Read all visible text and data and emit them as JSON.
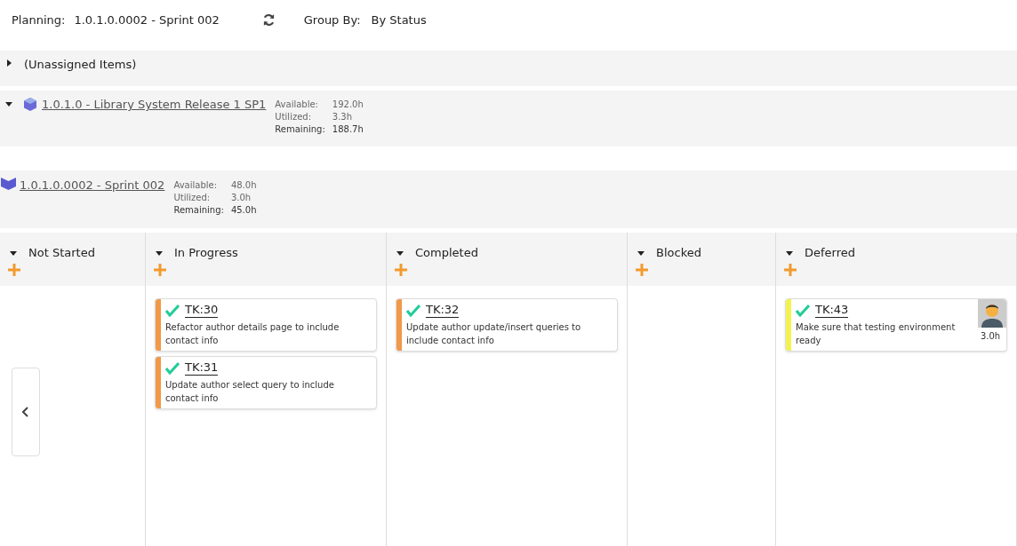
{
  "header": {
    "planning_label": "Planning:",
    "planning_value": "1.0.1.0.0002 - Sprint 002",
    "group_label": "Group By:",
    "group_value": "By Status"
  },
  "unassigned": {
    "label": "(Unassigned Items)",
    "expanded": false
  },
  "release": {
    "title": "1.0.1.0 - Library System Release 1 SP1",
    "expanded": true,
    "stats": [
      {
        "label": "Available:",
        "value": "192.0h"
      },
      {
        "label": "Utilized:",
        "value": "3.3h"
      },
      {
        "label": "Remaining:",
        "value": "188.7h"
      }
    ]
  },
  "sprint": {
    "title": "1.0.1.0.0002 - Sprint 002",
    "stats": [
      {
        "label": "Available:",
        "value": "48.0h"
      },
      {
        "label": "Utilized:",
        "value": "3.0h"
      },
      {
        "label": "Remaining:",
        "value": "45.0h"
      }
    ]
  },
  "columns": [
    {
      "title": "Not Started",
      "expanded": true
    },
    {
      "title": "In Progress",
      "expanded": true,
      "cards": [
        {
          "id": "TK:30",
          "text": "Refactor author details page to include contact info",
          "color": "#f0994a"
        },
        {
          "id": "TK:31",
          "text": "Update author select query to include contact info",
          "color": "#f0994a"
        }
      ]
    },
    {
      "title": "Completed",
      "expanded": true,
      "cards": [
        {
          "id": "TK:32",
          "text": "Update author update/insert queries to include contact info",
          "color": "#f0994a"
        }
      ]
    },
    {
      "title": "Blocked",
      "expanded": true
    },
    {
      "title": "Deferred",
      "expanded": true,
      "cards": [
        {
          "id": "TK:43",
          "text": "Make sure that testing environment ready",
          "color": "#f2f24f",
          "owner": true,
          "effort": "3.0h"
        }
      ]
    }
  ]
}
